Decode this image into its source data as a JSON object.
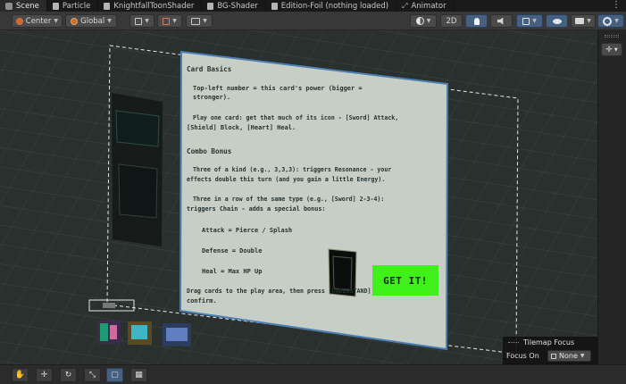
{
  "tabs": [
    {
      "label": "Scene",
      "icon": "scene-icon",
      "active": true
    },
    {
      "label": "Particle",
      "icon": "document-icon"
    },
    {
      "label": "KnightfallToonShader",
      "icon": "document-icon"
    },
    {
      "label": "BG-Shader",
      "icon": "document-icon"
    },
    {
      "label": "Edition-Foil (nothing loaded)",
      "icon": "document-icon"
    },
    {
      "label": "Animator",
      "icon": "animator-icon"
    }
  ],
  "toolbar": {
    "pivot_label": "Center",
    "space_label": "Global",
    "mode_2d_label": "2D"
  },
  "card": {
    "section1_title": "Card Basics",
    "line1a": "Top-left number = this card's power (bigger =",
    "line1b": "stronger).",
    "line2a": "Play one card: get that much of its icon - [Sword] Attack,",
    "line2b": "[Shield] Block, [Heart] Heal.",
    "section2_title": "Combo Bonus",
    "line3a": "Three of a kind (e.g., 3,3,3): triggers Resonance - your",
    "line3b": "effects double this turn (and you gain a little Energy).",
    "line4a": "Three in a row of the same type (e.g., [Sword] 2-3-4):",
    "line4b": "triggers Chain - adds a special bonus:",
    "bonus_attack": "Attack = Pierce / Splash",
    "bonus_defense": "Defense = Double",
    "bonus_heal": "Heal = Max HP Up",
    "footer_a": "Drag cards to the play area, then press [UNDERSTAND] to",
    "footer_b": "confirm.",
    "cta_label": "GET IT!"
  },
  "tilemap_focus": {
    "title": "Tilemap Focus",
    "label": "Focus On",
    "value": "None"
  },
  "colors": {
    "accent": "#46607f",
    "cta_green": "#3ff01a",
    "card_bg": "#c6cec6",
    "scene_bg": "#29302d"
  }
}
